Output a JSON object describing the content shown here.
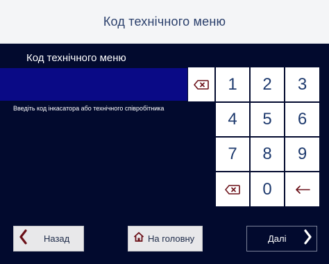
{
  "header": {
    "title": "Код технічного меню"
  },
  "form": {
    "section_title": "Код технічного меню",
    "code_value": "",
    "hint": "Введіть код інкасатора або технічного співробітника"
  },
  "keypad": {
    "keys": [
      "1",
      "2",
      "3",
      "4",
      "5",
      "6",
      "7",
      "8",
      "9",
      "0"
    ]
  },
  "footer": {
    "back_label": "Назад",
    "home_label": "На головну",
    "next_label": "Далі"
  },
  "colors": {
    "background": "#020a2e",
    "input_fill": "#0a0a86",
    "header_bg": "#f4f5f7",
    "accent_dark_red": "#6b1018",
    "digit_color": "#1e3a6e"
  },
  "icons": {
    "clear_input": "backspace-x-icon",
    "keypad_clear": "backspace-x-icon",
    "keypad_back": "arrow-left-icon",
    "back": "chevron-left-icon",
    "home": "home-icon",
    "next": "chevron-right-icon"
  }
}
